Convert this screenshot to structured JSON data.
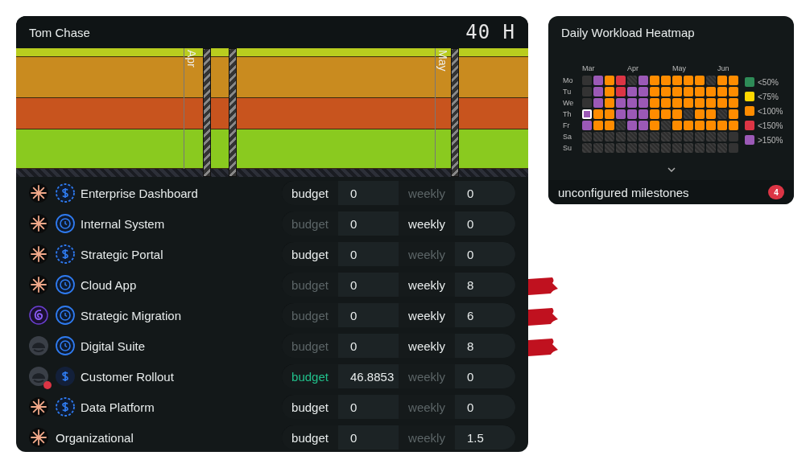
{
  "person_panel": {
    "name": "Tom Chase",
    "hours": "40 H",
    "timeline": {
      "bands": [
        {
          "color": "#b9cd1f"
        },
        {
          "color": "#c98b1f"
        },
        {
          "color": "#c8541e"
        },
        {
          "color": "#8aca1f"
        }
      ],
      "months": [
        {
          "label": "Apr"
        },
        {
          "label": "May"
        }
      ]
    },
    "projects": [
      {
        "avatar": {
          "kind": "asterisk"
        },
        "type_icon": {
          "kind": "dollar-dashed"
        },
        "name": "Enterprise Dashboard",
        "budget_label": "budget",
        "budget_on": true,
        "budget_met": false,
        "budget_value": "0",
        "weekly_label": "weekly",
        "weekly_on": false,
        "weekly_value": "0",
        "flagged": false,
        "alert": false
      },
      {
        "avatar": {
          "kind": "asterisk"
        },
        "type_icon": {
          "kind": "clock"
        },
        "name": "Internal System",
        "budget_label": "budget",
        "budget_on": false,
        "budget_met": false,
        "budget_value": "0",
        "weekly_label": "weekly",
        "weekly_on": true,
        "weekly_value": "0",
        "flagged": false,
        "alert": false
      },
      {
        "avatar": {
          "kind": "asterisk"
        },
        "type_icon": {
          "kind": "dollar-dashed"
        },
        "name": "Strategic Portal",
        "budget_label": "budget",
        "budget_on": true,
        "budget_met": false,
        "budget_value": "0",
        "weekly_label": "weekly",
        "weekly_on": false,
        "weekly_value": "0",
        "flagged": false,
        "alert": false
      },
      {
        "avatar": {
          "kind": "asterisk"
        },
        "type_icon": {
          "kind": "clock"
        },
        "name": "Cloud App",
        "budget_label": "budget",
        "budget_on": false,
        "budget_met": false,
        "budget_value": "0",
        "weekly_label": "weekly",
        "weekly_on": true,
        "weekly_value": "8",
        "flagged": true,
        "alert": false
      },
      {
        "avatar": {
          "kind": "swirl"
        },
        "type_icon": {
          "kind": "clock"
        },
        "name": "Strategic Migration",
        "budget_label": "budget",
        "budget_on": false,
        "budget_met": false,
        "budget_value": "0",
        "weekly_label": "weekly",
        "weekly_on": true,
        "weekly_value": "6",
        "flagged": true,
        "alert": false
      },
      {
        "avatar": {
          "kind": "helmet"
        },
        "type_icon": {
          "kind": "clock"
        },
        "name": "Digital Suite",
        "budget_label": "budget",
        "budget_on": false,
        "budget_met": false,
        "budget_value": "0",
        "weekly_label": "weekly",
        "weekly_on": true,
        "weekly_value": "8",
        "flagged": true,
        "alert": false
      },
      {
        "avatar": {
          "kind": "helmet"
        },
        "type_icon": {
          "kind": "dollar-solid"
        },
        "name": "Customer Rollout",
        "budget_label": "budget",
        "budget_on": true,
        "budget_met": true,
        "budget_value": "46.8853",
        "weekly_label": "weekly",
        "weekly_on": false,
        "weekly_value": "0",
        "flagged": false,
        "alert": true
      },
      {
        "avatar": {
          "kind": "asterisk"
        },
        "type_icon": {
          "kind": "dollar-dashed"
        },
        "name": "Data Platform",
        "budget_label": "budget",
        "budget_on": true,
        "budget_met": false,
        "budget_value": "0",
        "weekly_label": "weekly",
        "weekly_on": false,
        "weekly_value": "0",
        "flagged": false,
        "alert": false
      },
      {
        "avatar": {
          "kind": "asterisk"
        },
        "name": "Organizational",
        "budget_label": "budget",
        "budget_on": true,
        "budget_met": false,
        "budget_value": "0",
        "weekly_label": "weekly",
        "weekly_on": false,
        "weekly_value": "1.5",
        "flagged": false,
        "alert": false
      }
    ]
  },
  "heatmap": {
    "title": "Daily Workload Heatmap",
    "months": [
      {
        "label": "Mar"
      },
      {
        "label": "Apr"
      },
      {
        "label": "May"
      },
      {
        "label": "Jun"
      }
    ],
    "days": [
      {
        "label": "Mo",
        "cells": [
          {
            "kind": "none",
            "selected": false
          },
          {
            "kind": "gt150",
            "selected": false
          },
          {
            "kind": "lt100",
            "selected": false
          },
          {
            "kind": "lt150",
            "selected": false
          },
          {
            "kind": "off",
            "selected": false
          },
          {
            "kind": "gt150",
            "selected": false
          },
          {
            "kind": "lt100",
            "selected": false
          },
          {
            "kind": "lt100",
            "selected": false
          },
          {
            "kind": "lt100",
            "selected": false
          },
          {
            "kind": "lt100",
            "selected": false
          },
          {
            "kind": "lt100",
            "selected": false
          },
          {
            "kind": "off",
            "selected": false
          },
          {
            "kind": "lt100",
            "selected": false
          },
          {
            "kind": "lt100",
            "selected": false
          }
        ]
      },
      {
        "label": "Tu",
        "cells": [
          {
            "kind": "none",
            "selected": false
          },
          {
            "kind": "gt150",
            "selected": false
          },
          {
            "kind": "lt100",
            "selected": false
          },
          {
            "kind": "lt150",
            "selected": false
          },
          {
            "kind": "gt150",
            "selected": false
          },
          {
            "kind": "gt150",
            "selected": false
          },
          {
            "kind": "lt100",
            "selected": false
          },
          {
            "kind": "lt100",
            "selected": false
          },
          {
            "kind": "lt100",
            "selected": false
          },
          {
            "kind": "lt100",
            "selected": false
          },
          {
            "kind": "lt100",
            "selected": false
          },
          {
            "kind": "lt100",
            "selected": false
          },
          {
            "kind": "lt100",
            "selected": false
          },
          {
            "kind": "lt100",
            "selected": false
          }
        ]
      },
      {
        "label": "We",
        "cells": [
          {
            "kind": "none",
            "selected": false
          },
          {
            "kind": "gt150",
            "selected": false
          },
          {
            "kind": "lt100",
            "selected": false
          },
          {
            "kind": "gt150",
            "selected": false
          },
          {
            "kind": "gt150",
            "selected": false
          },
          {
            "kind": "gt150",
            "selected": false
          },
          {
            "kind": "lt100",
            "selected": false
          },
          {
            "kind": "lt100",
            "selected": false
          },
          {
            "kind": "lt100",
            "selected": false
          },
          {
            "kind": "lt100",
            "selected": false
          },
          {
            "kind": "lt100",
            "selected": false
          },
          {
            "kind": "lt100",
            "selected": false
          },
          {
            "kind": "lt100",
            "selected": false
          },
          {
            "kind": "lt100",
            "selected": false
          }
        ]
      },
      {
        "label": "Th",
        "cells": [
          {
            "kind": "gt150",
            "selected": true
          },
          {
            "kind": "lt100",
            "selected": false
          },
          {
            "kind": "lt100",
            "selected": false
          },
          {
            "kind": "gt150",
            "selected": false
          },
          {
            "kind": "gt150",
            "selected": false
          },
          {
            "kind": "gt150",
            "selected": false
          },
          {
            "kind": "lt100",
            "selected": false
          },
          {
            "kind": "lt100",
            "selected": false
          },
          {
            "kind": "lt100",
            "selected": false
          },
          {
            "kind": "off",
            "selected": false
          },
          {
            "kind": "lt100",
            "selected": false
          },
          {
            "kind": "lt100",
            "selected": false
          },
          {
            "kind": "off",
            "selected": false
          },
          {
            "kind": "lt100",
            "selected": false
          }
        ]
      },
      {
        "label": "Fr",
        "cells": [
          {
            "kind": "gt150",
            "selected": false
          },
          {
            "kind": "lt100",
            "selected": false
          },
          {
            "kind": "lt100",
            "selected": false
          },
          {
            "kind": "off",
            "selected": false
          },
          {
            "kind": "gt150",
            "selected": false
          },
          {
            "kind": "gt150",
            "selected": false
          },
          {
            "kind": "lt100",
            "selected": false
          },
          {
            "kind": "off",
            "selected": false
          },
          {
            "kind": "lt100",
            "selected": false
          },
          {
            "kind": "lt100",
            "selected": false
          },
          {
            "kind": "lt100",
            "selected": false
          },
          {
            "kind": "lt100",
            "selected": false
          },
          {
            "kind": "lt100",
            "selected": false
          },
          {
            "kind": "lt100",
            "selected": false
          }
        ]
      },
      {
        "label": "Sa",
        "cells": [
          {
            "kind": "off",
            "selected": false
          },
          {
            "kind": "off",
            "selected": false
          },
          {
            "kind": "off",
            "selected": false
          },
          {
            "kind": "off",
            "selected": false
          },
          {
            "kind": "off",
            "selected": false
          },
          {
            "kind": "off",
            "selected": false
          },
          {
            "kind": "off",
            "selected": false
          },
          {
            "kind": "off",
            "selected": false
          },
          {
            "kind": "off",
            "selected": false
          },
          {
            "kind": "off",
            "selected": false
          },
          {
            "kind": "off",
            "selected": false
          },
          {
            "kind": "off",
            "selected": false
          },
          {
            "kind": "off",
            "selected": false
          },
          {
            "kind": "none",
            "selected": false
          }
        ]
      },
      {
        "label": "Su",
        "cells": [
          {
            "kind": "off",
            "selected": false
          },
          {
            "kind": "off",
            "selected": false
          },
          {
            "kind": "off",
            "selected": false
          },
          {
            "kind": "off",
            "selected": false
          },
          {
            "kind": "off",
            "selected": false
          },
          {
            "kind": "off",
            "selected": false
          },
          {
            "kind": "off",
            "selected": false
          },
          {
            "kind": "off",
            "selected": false
          },
          {
            "kind": "off",
            "selected": false
          },
          {
            "kind": "off",
            "selected": false
          },
          {
            "kind": "off",
            "selected": false
          },
          {
            "kind": "off",
            "selected": false
          },
          {
            "kind": "off",
            "selected": false
          },
          {
            "kind": "none",
            "selected": false
          }
        ]
      }
    ],
    "legend": [
      {
        "label": "<50%",
        "color": "#2e8b57"
      },
      {
        "label": "<75%",
        "color": "#ffd700"
      },
      {
        "label": "<100%",
        "color": "#ff8c00"
      },
      {
        "label": "<150%",
        "color": "#dc3545"
      },
      {
        "label": ">150%",
        "color": "#9b59b6"
      }
    ],
    "footer": {
      "label": "unconfigured milestones",
      "count": "4"
    }
  }
}
